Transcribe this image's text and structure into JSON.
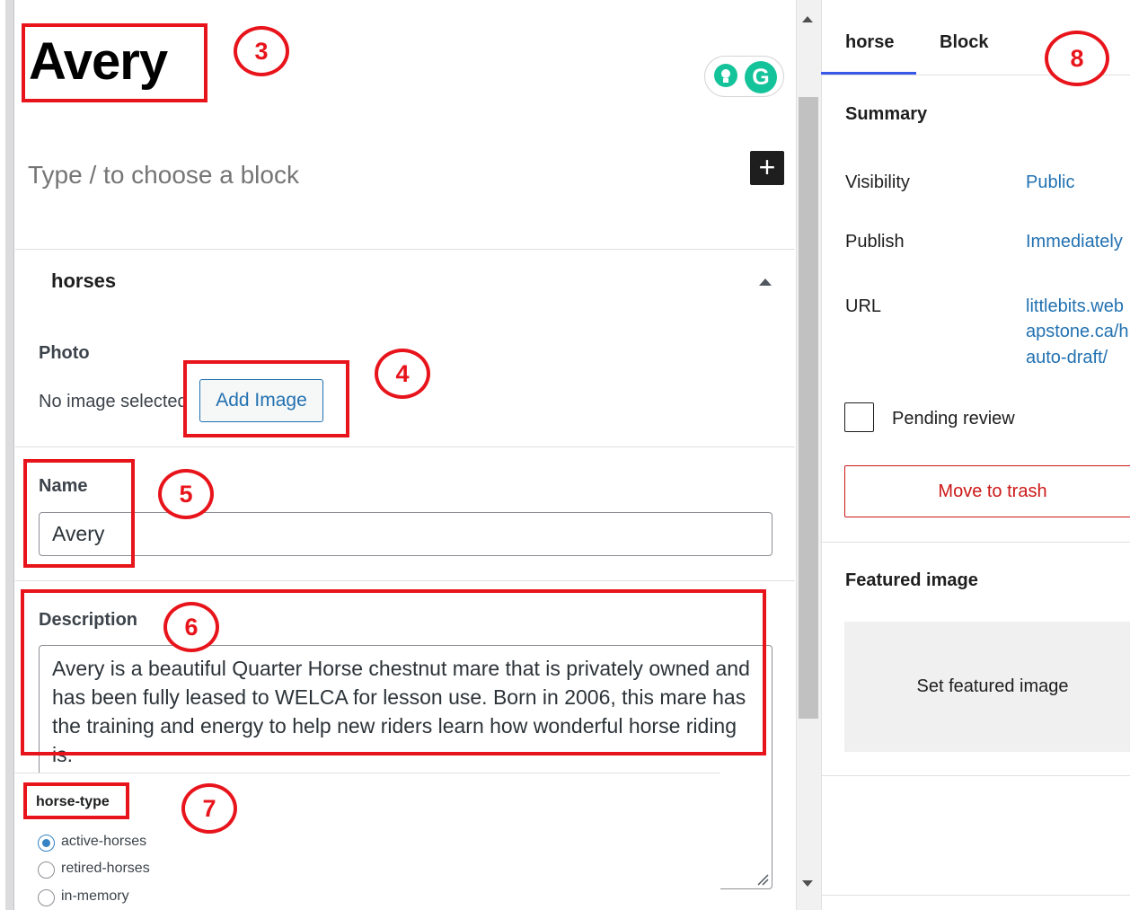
{
  "editor": {
    "post_title": "Avery",
    "block_placeholder": "Type / to choose a block",
    "add_block_symbol": "+",
    "grammarly_letter": "G"
  },
  "metabox": {
    "title": "horses",
    "photo": {
      "label": "Photo",
      "status": "No image selected",
      "button_label": "Add Image"
    },
    "name": {
      "label": "Name",
      "value": "Avery"
    },
    "description": {
      "label": "Description",
      "value": "Avery is a beautiful Quarter Horse chestnut mare that is privately owned and has been fully leased to WELCA for lesson use. Born in 2006, this mare has the training and energy to help new riders learn how wonderful horse riding is."
    }
  },
  "taxonomy": {
    "label": "horse-type",
    "options": [
      {
        "label": "active-horses",
        "checked": true
      },
      {
        "label": "retired-horses",
        "checked": false
      },
      {
        "label": "in-memory",
        "checked": false
      }
    ]
  },
  "sidebar": {
    "tabs": [
      {
        "label": "horse",
        "active": true
      },
      {
        "label": "Block",
        "active": false
      }
    ],
    "summary": {
      "heading": "Summary",
      "visibility_label": "Visibility",
      "visibility_value": "Public",
      "publish_label": "Publish",
      "publish_value": "Immediately",
      "url_label": "URL",
      "url_lines": [
        "littlebits.web",
        "apstone.ca/h",
        "auto-draft/"
      ],
      "pending_label": "Pending review",
      "trash_label": "Move to trash"
    },
    "featured": {
      "heading": "Featured image",
      "button_label": "Set featured image"
    }
  },
  "annotations": [
    "3",
    "4",
    "5",
    "6",
    "7",
    "8"
  ],
  "colors": {
    "annotation_red": "#e8141b",
    "link_blue": "#2271b1",
    "tab_accent": "#3858e9",
    "trash_red": "#cc1818",
    "grammarly_green": "#15c39a"
  }
}
